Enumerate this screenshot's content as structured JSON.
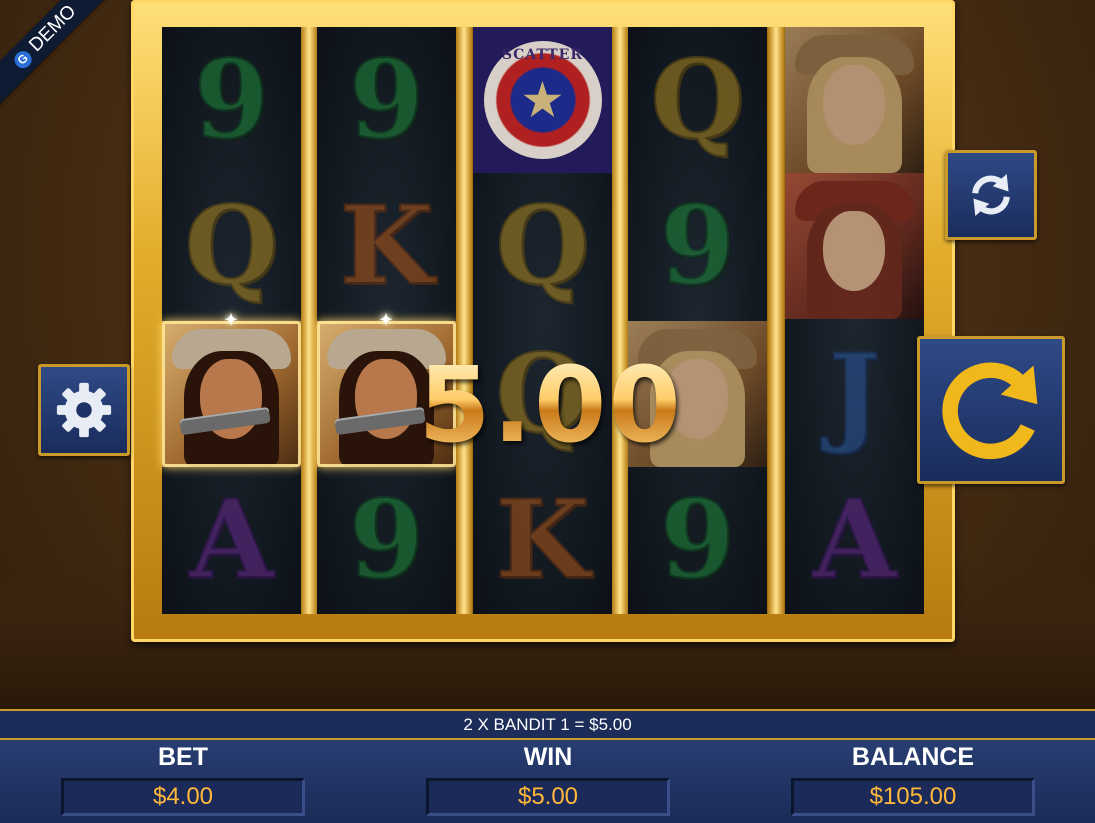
{
  "demo_badge": {
    "logo": "G",
    "label": "DEMO"
  },
  "reels": [
    [
      "9",
      "Q",
      "bandit-portrait",
      "A"
    ],
    [
      "9",
      "K",
      "bandit-portrait",
      "9"
    ],
    [
      "scatter",
      "Q",
      "Q",
      "K"
    ],
    [
      "Q",
      "9",
      "blonde-portrait",
      "9"
    ],
    [
      "blonde-portrait",
      "redhead-portrait",
      "J",
      "A"
    ]
  ],
  "scatter_symbol": {
    "text": "SCATTER"
  },
  "win_display": {
    "amount": "5.00"
  },
  "ticker": {
    "message": "2 X BANDIT 1 = $5.00"
  },
  "meters": {
    "bet": {
      "label": "BET",
      "value": "$4.00"
    },
    "win": {
      "label": "WIN",
      "value": "$5.00"
    },
    "balance": {
      "label": "BALANCE",
      "value": "$105.00"
    }
  },
  "buttons": {
    "settings": {
      "icon": "gear-icon"
    },
    "autoplay": {
      "icon": "refresh-arrows-icon"
    },
    "spin": {
      "icon": "circular-arrow-icon"
    }
  },
  "colors": {
    "frame_gold": "#e3ac2a",
    "button_blue": "#1a2c5c",
    "meter_value": "#ffb83a",
    "spin_arrow": "#f0b81a"
  }
}
